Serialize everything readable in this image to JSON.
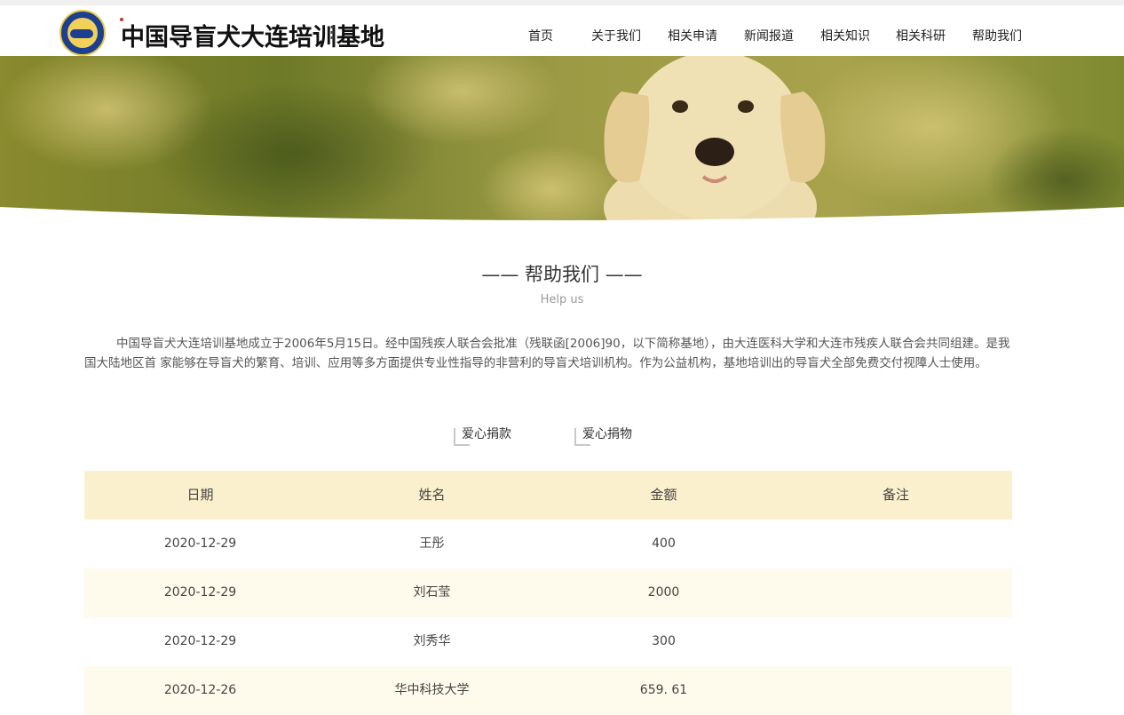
{
  "header": {
    "logo_title": "中国导盲犬大连培训基地",
    "nav": [
      "首页",
      "关于我们",
      "相关申请",
      "新闻报道",
      "相关知识",
      "相关科研",
      "帮助我们"
    ]
  },
  "section": {
    "title": "—— 帮助我们 ——",
    "subtitle": "Help us",
    "intro": "中国导盲犬大连培训基地成立于2006年5月15日。经中国残疾人联合会批准（残联函[2006]90，以下简称基地），由大连医科大学和大连市残疾人联合会共同组建。是我国大陆地区首 家能够在导盲犬的繁育、培训、应用等多方面提供专业性指导的非营利的导盲犬培训机构。作为公益机构，基地培训出的导盲犬全部免费交付视障人士使用。"
  },
  "tabs": [
    "爱心捐款",
    "爱心捐物"
  ],
  "table": {
    "headers": [
      "日期",
      "姓名",
      "金额",
      "备注"
    ],
    "rows": [
      [
        "2020-12-29",
        "王彤",
        "400",
        ""
      ],
      [
        "2020-12-29",
        "刘石莹",
        "2000",
        ""
      ],
      [
        "2020-12-29",
        "刘秀华",
        "300",
        ""
      ],
      [
        "2020-12-26",
        "华中科技大学",
        "659. 61",
        ""
      ]
    ]
  },
  "colors": {
    "table_header_bg": "#fbf0cd",
    "table_alt_bg": "#fefaec"
  }
}
